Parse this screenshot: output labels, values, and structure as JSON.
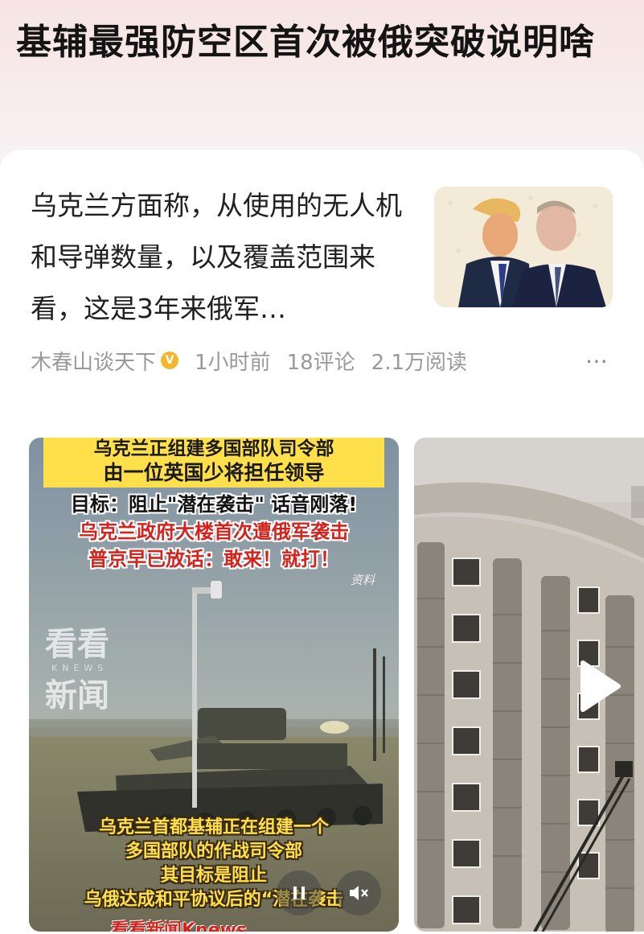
{
  "article": {
    "title": "基辅最强防空区首次被俄突破说明啥",
    "summary": "乌克兰方面称，从使用的无人机和导弹数量，以及覆盖范围来看，这是3年来俄军…",
    "author": "木春山谈天下",
    "time": "1小时前",
    "comments": "18评论",
    "reads": "2.1万阅读",
    "more_icon": "more-dots-icon",
    "verified_icon": "verified-badge-icon"
  },
  "video1": {
    "banner_line1": "乌克兰正组建多国部队司令部",
    "banner_line2": "由一位英国少将担任领导",
    "line_goal": "目标：阻止\"潜在袭击\" 话音刚落!",
    "line_gov": "乌克兰政府大楼首次遭俄军袭击",
    "line_putin": "普京早已放话：敢来！就打！",
    "source_tag": "资料",
    "watermark_top": "看看",
    "watermark_knews": "KNEWS",
    "watermark_bottom": "新闻",
    "caption_1": "乌克兰首都基辅正在组建一个",
    "caption_2": "多国部队的作战司令部",
    "caption_3": "其目标是阻止",
    "caption_4": "乌俄达成和平协议后的“潜在袭击",
    "brand": "看看新闻Knews",
    "pause_icon": "pause-icon",
    "mute_icon": "mute-icon"
  },
  "video2": {
    "play_icon": "play-icon"
  },
  "colors": {
    "accent_red": "#d4231d",
    "banner_yellow": "#ffe04a",
    "meta_gray": "#9a9a9a"
  }
}
